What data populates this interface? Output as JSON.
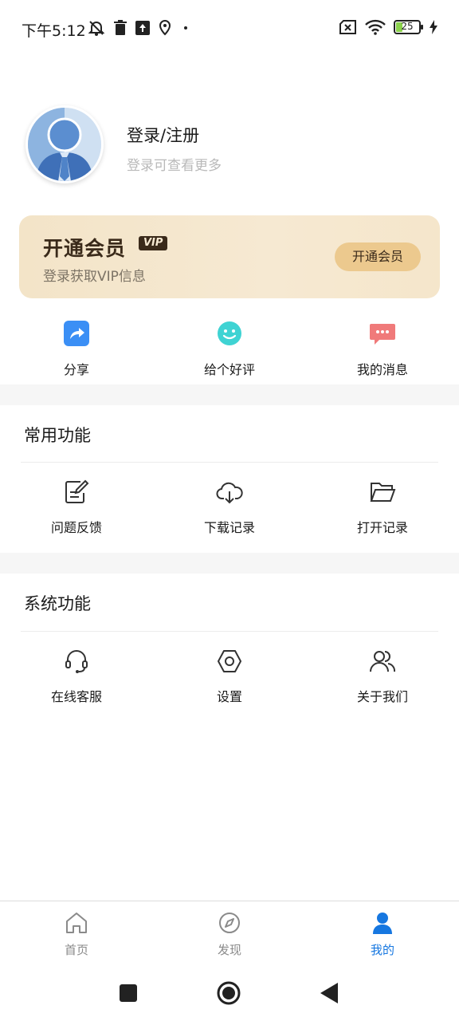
{
  "status_bar": {
    "time": "下午5:12",
    "battery": "25"
  },
  "profile": {
    "name": "登录/注册",
    "subtitle": "登录可查看更多"
  },
  "vip": {
    "title": "开通会员",
    "badge": "VIP",
    "subtitle": "登录获取VIP信息",
    "button": "开通会员"
  },
  "quick_actions": [
    {
      "label": "分享",
      "icon": "share-icon"
    },
    {
      "label": "给个好评",
      "icon": "smile-icon"
    },
    {
      "label": "我的消息",
      "icon": "message-icon"
    }
  ],
  "common": {
    "title": "常用功能",
    "items": [
      {
        "label": "问题反馈",
        "icon": "feedback-icon"
      },
      {
        "label": "下载记录",
        "icon": "cloud-download-icon"
      },
      {
        "label": "打开记录",
        "icon": "folder-icon"
      }
    ]
  },
  "system": {
    "title": "系统功能",
    "items": [
      {
        "label": "在线客服",
        "icon": "headset-icon"
      },
      {
        "label": "设置",
        "icon": "hexagon-settings-icon"
      },
      {
        "label": "关于我们",
        "icon": "users-icon"
      }
    ]
  },
  "bottom_nav": [
    {
      "label": "首页",
      "icon": "home-icon",
      "active": false
    },
    {
      "label": "发现",
      "icon": "compass-icon",
      "active": false
    },
    {
      "label": "我的",
      "icon": "person-icon",
      "active": true
    }
  ],
  "colors": {
    "accent": "#1677e0",
    "vip_button": "#ecc98e",
    "share_icon": "#3b8ff5",
    "smile_icon": "#3fd3d3",
    "message_icon": "#f07a7a"
  }
}
